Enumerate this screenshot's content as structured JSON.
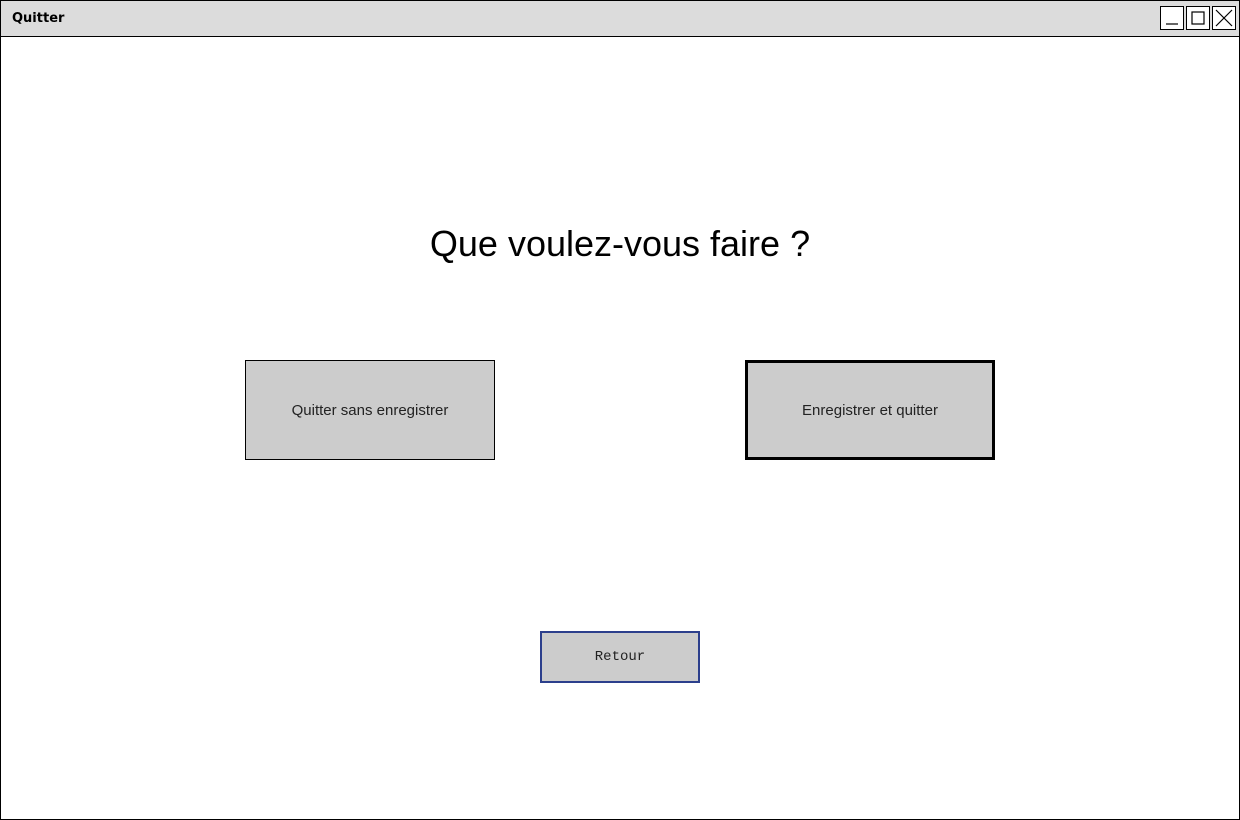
{
  "window": {
    "title": "Quitter"
  },
  "dialog": {
    "heading": "Que voulez-vous faire ?",
    "quit_without_saving_label": "Quitter sans enregistrer",
    "save_and_quit_label": "Enregistrer et quitter",
    "back_label": "Retour"
  },
  "colors": {
    "titlebar": "#dcdcdc",
    "button_fill": "#cccccc",
    "back_button_border": "#2c3f8c"
  },
  "icons": [
    "minimize-icon",
    "maximize-icon",
    "close-icon"
  ]
}
